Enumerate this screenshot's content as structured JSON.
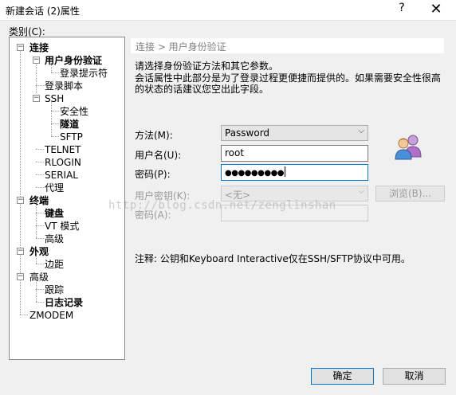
{
  "window": {
    "title": "新建会话 (2)属性",
    "help_label": "?",
    "close_label": "✕"
  },
  "category_label": "类别(C):",
  "tree": {
    "items": [
      {
        "label": "连接",
        "bold": true
      },
      {
        "label": "用户身份验证",
        "bold": true
      },
      {
        "label": "登录提示符",
        "bold": false
      },
      {
        "label": "登录脚本",
        "bold": false
      },
      {
        "label": "SSH",
        "bold": false
      },
      {
        "label": "安全性",
        "bold": false
      },
      {
        "label": "隧道",
        "bold": true
      },
      {
        "label": "SFTP",
        "bold": false
      },
      {
        "label": "TELNET",
        "bold": false
      },
      {
        "label": "RLOGIN",
        "bold": false
      },
      {
        "label": "SERIAL",
        "bold": false
      },
      {
        "label": "代理",
        "bold": false
      },
      {
        "label": "终端",
        "bold": true
      },
      {
        "label": "键盘",
        "bold": true
      },
      {
        "label": "VT 模式",
        "bold": false
      },
      {
        "label": "高级",
        "bold": false
      },
      {
        "label": "外观",
        "bold": true
      },
      {
        "label": "边距",
        "bold": false
      },
      {
        "label": "高级",
        "bold": false
      },
      {
        "label": "跟踪",
        "bold": false
      },
      {
        "label": "日志记录",
        "bold": true
      },
      {
        "label": "ZMODEM",
        "bold": false
      }
    ]
  },
  "panel": {
    "breadcrumb": "连接 > 用户身份验证",
    "desc1": "请选择身份验证方法和其它参数。",
    "desc2": "会话属性中此部分是为了登录过程更便捷而提供的。如果需要安全性很高的状态的话建议您空出此字段。",
    "method_label": "方法(M):",
    "method_value": "Password",
    "username_label": "用户名(U):",
    "username_value": "root",
    "password_label": "密码(P):",
    "password_value": "●●●●●●●●●",
    "userkey_label": "用户密钥(K):",
    "userkey_value": "<无>",
    "browse_label": "浏览(B)...",
    "passphrase_label": "密码(A):",
    "note": "注释: 公钥和Keyboard Interactive仅在SSH/SFTP协议中可用。",
    "watermark": "http://blog.csdn.net/zenglinshan"
  },
  "buttons": {
    "ok": "确定",
    "cancel": "取消"
  },
  "colors": {
    "accent": "#0078d7",
    "panel_bg": "#f0f0f0"
  }
}
